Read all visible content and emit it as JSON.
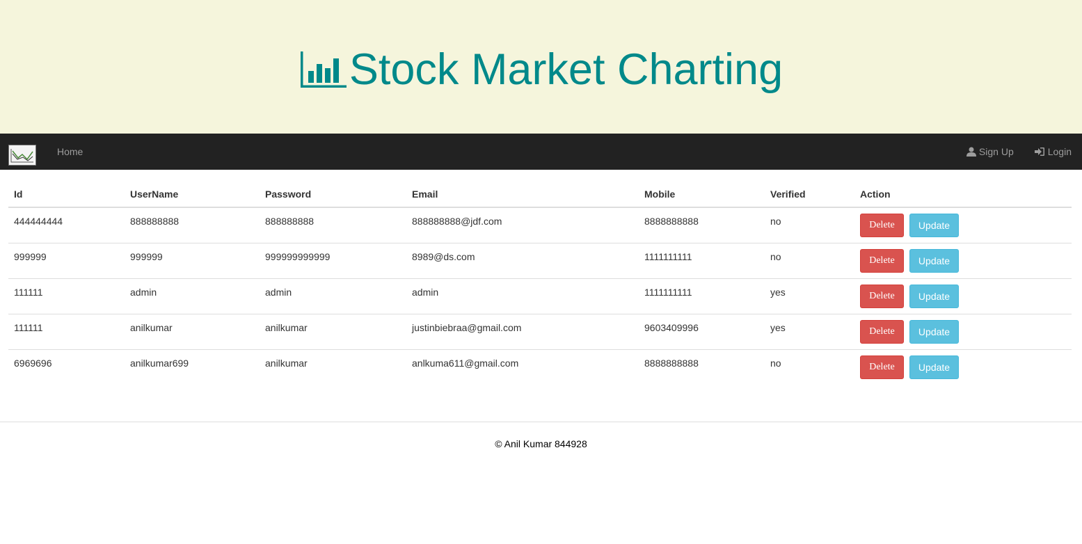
{
  "banner": {
    "title": "Stock Market Charting",
    "icon": "bar-chart-icon",
    "title_color": "#00898a",
    "background": "#f5f5dc"
  },
  "navbar": {
    "logo_icon": "line-chart-logo-icon",
    "home_label": "Home",
    "signup_label": "Sign Up",
    "login_label": "Login",
    "background": "#222222"
  },
  "table": {
    "headers": [
      "Id",
      "UserName",
      "Password",
      "Email",
      "Mobile",
      "Verified",
      "Action"
    ],
    "rows": [
      {
        "id": "444444444",
        "username": "888888888",
        "password": "888888888",
        "email": "888888888@jdf.com",
        "mobile": "8888888888",
        "verified": "no"
      },
      {
        "id": "999999",
        "username": "999999",
        "password": "999999999999",
        "email": "8989@ds.com",
        "mobile": "1111111111",
        "verified": "no"
      },
      {
        "id": "111111",
        "username": "admin",
        "password": "admin",
        "email": "admin",
        "mobile": "1111111111",
        "verified": "yes"
      },
      {
        "id": "111111",
        "username": "anilkumar",
        "password": "anilkumar",
        "email": "justinbiebraa@gmail.com",
        "mobile": "9603409996",
        "verified": "yes"
      },
      {
        "id": "6969696",
        "username": "anilkumar699",
        "password": "anilkumar",
        "email": "anlkuma611@gmail.com",
        "mobile": "8888888888",
        "verified": "no"
      }
    ],
    "delete_label": "Delete",
    "update_label": "Update",
    "delete_color": "#d9534f",
    "update_color": "#5bc0de"
  },
  "footer": {
    "text": "© Anil Kumar 844928"
  }
}
